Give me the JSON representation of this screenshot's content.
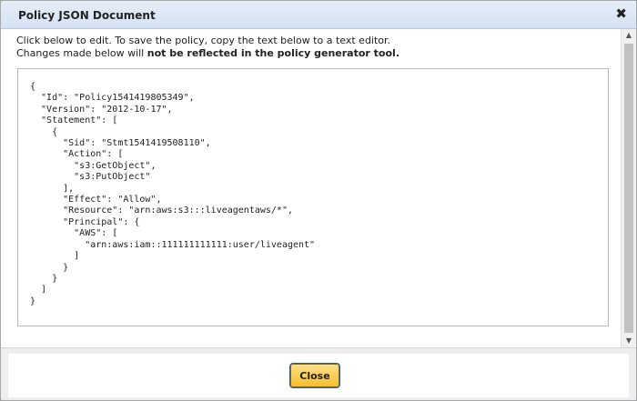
{
  "dialog": {
    "title": "Policy JSON Document",
    "close_icon": "✖",
    "intro_line1": "Click below to edit. To save the policy, copy the text below to a text editor.",
    "intro_line2_prefix": "Changes made below will ",
    "intro_line2_bold": "not be reflected in the policy generator tool.",
    "json_text": "{\n  \"Id\": \"Policy1541419805349\",\n  \"Version\": \"2012-10-17\",\n  \"Statement\": [\n    {\n      \"Sid\": \"Stmt1541419508110\",\n      \"Action\": [\n        \"s3:GetObject\",\n        \"s3:PutObject\"\n      ],\n      \"Effect\": \"Allow\",\n      \"Resource\": \"arn:aws:s3:::liveagentaws/*\",\n      \"Principal\": {\n        \"AWS\": [\n          \"arn:aws:iam::111111111111:user/liveagent\"\n        ]\n      }\n    }\n  ]\n}",
    "close_button_label": "Close"
  },
  "scrollbar": {
    "up_arrow": "▲",
    "down_arrow": "▼"
  },
  "colors": {
    "titlebar": "#d5e2f3",
    "close_button": "#f5be2b",
    "focus_ring": "#2a5db0"
  }
}
